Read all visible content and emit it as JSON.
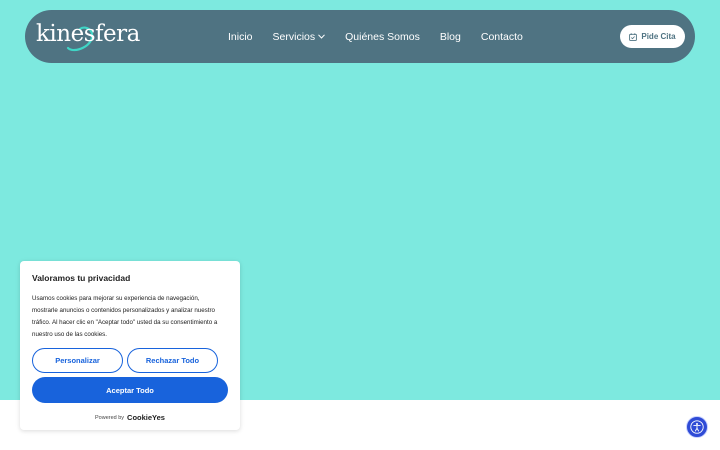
{
  "header": {
    "logo_text": "kinesfera",
    "nav": [
      {
        "label": "Inicio"
      },
      {
        "label": "Servicios"
      },
      {
        "label": "Quiénes Somos"
      },
      {
        "label": "Blog"
      },
      {
        "label": "Contacto"
      }
    ],
    "cta_label": "Pide Cita",
    "cta_icon": "calendar-icon"
  },
  "cookie_banner": {
    "title": "Valoramos tu privacidad",
    "body": "Usamos cookies para mejorar su experiencia de navegación, mostrarle anuncios o contenidos personalizados y analizar nuestro tráfico. Al hacer clic en \"Aceptar todo\" usted da su consentimiento a nuestro uso de las cookies.",
    "customize_label": "Personalizar",
    "reject_label": "Rechazar Todo",
    "accept_label": "Aceptar Todo",
    "powered_by": "Powered by",
    "powered_brand": "CookieYes"
  },
  "colors": {
    "hero_bg": "#7de9df",
    "nav_bg": "#4f7382",
    "accent_blue": "#1863dc",
    "logo_swoosh": "#3fd6c6"
  },
  "accessibility_icon": "accessibility-icon"
}
